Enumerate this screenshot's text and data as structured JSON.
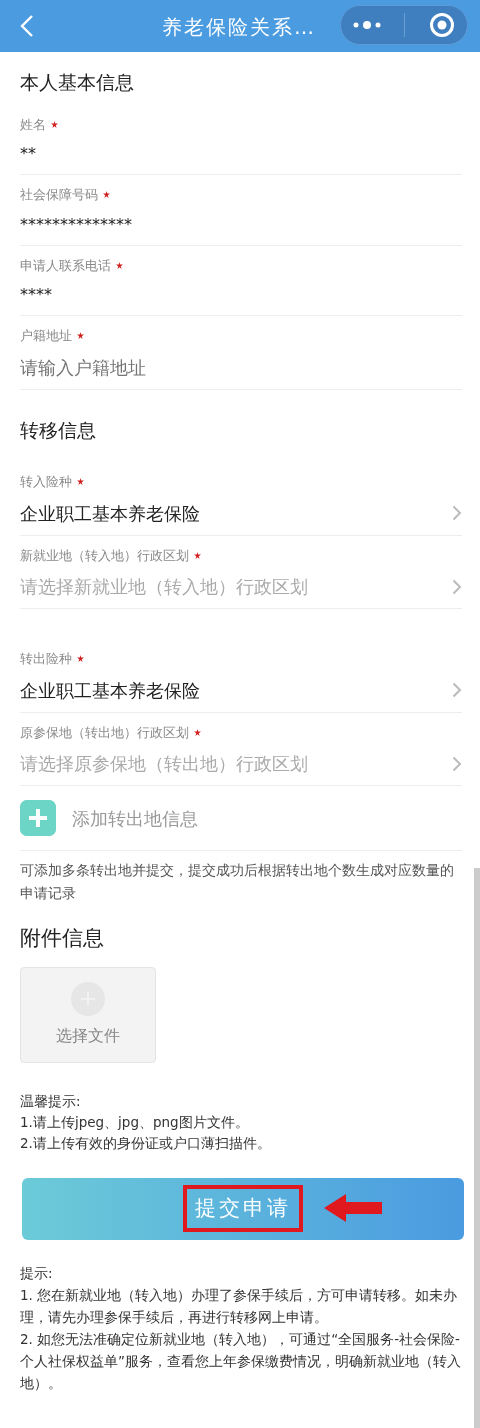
{
  "header": {
    "title": "养老保险关系…"
  },
  "personal": {
    "title": "本人基本信息",
    "fields": [
      {
        "kind": "text",
        "label": "姓名",
        "required": true,
        "value": "**"
      },
      {
        "kind": "text",
        "label": "社会保障号码",
        "required": true,
        "value": "**************"
      },
      {
        "kind": "text",
        "label": "申请人联系电话",
        "required": true,
        "value": "****"
      },
      {
        "kind": "input",
        "label": "户籍地址",
        "required": true,
        "placeholder": "请输入户籍地址"
      }
    ]
  },
  "transfer": {
    "title": "转移信息",
    "groups": [
      [
        {
          "kind": "select",
          "label": "转入险种",
          "required": true,
          "value": "企业职工基本养老保险"
        },
        {
          "kind": "select",
          "label": "新就业地（转入地）行政区划",
          "required": true,
          "placeholder": "请选择新就业地（转入地）行政区划"
        }
      ],
      [
        {
          "kind": "select",
          "label": "转出险种",
          "required": true,
          "value": "企业职工基本养老保险"
        },
        {
          "kind": "select",
          "label": "原参保地（转出地）行政区划",
          "required": true,
          "placeholder": "请选择原参保地（转出地）行政区划"
        }
      ]
    ],
    "add_label": "添加转出地信息",
    "note": "可添加多条转出地并提交，提交成功后根据转出地个数生成对应数量的申请记录"
  },
  "attachments": {
    "title": "附件信息",
    "upload_label": "选择文件",
    "tips": [
      "温馨提示:",
      "1.请上传jpeg、jpg、png图片文件。",
      "2.请上传有效的身份证或户口薄扫描件。"
    ]
  },
  "submit": {
    "label": "提交申请",
    "highlighted": true
  },
  "hints": [
    "提示:",
    "1. 您在新就业地（转入地）办理了参保手续后，方可申请转移。如未办理，请先办理参保手续后，再进行转移网上申请。",
    "2. 如您无法准确定位新就业地（转入地），可通过“全国服务-社会保险-个人社保权益单”服务，查看您上年参保缴费情况，明确新就业地（转入地）。"
  ]
}
